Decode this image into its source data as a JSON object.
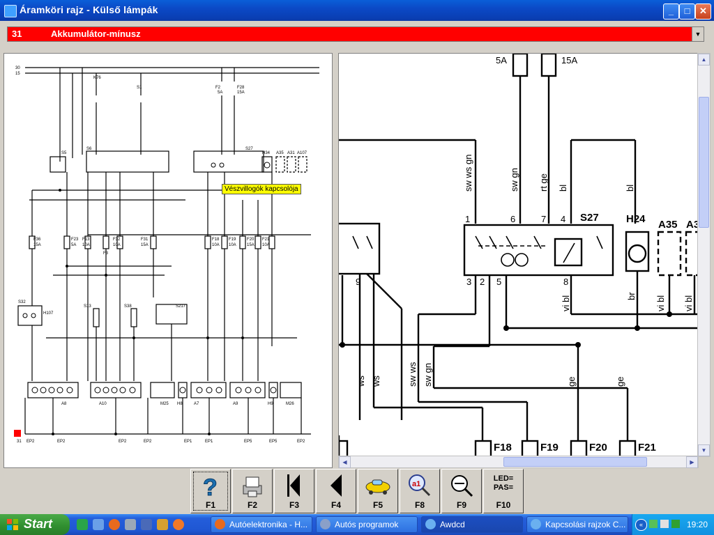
{
  "window": {
    "title": "Áramköri rajz - Külső lámpák",
    "minimize_label": "_",
    "maximize_label": "□",
    "close_label": "✕"
  },
  "selector": {
    "code": "31",
    "label": "Akkumulátor-mínusz"
  },
  "tooltip": "Vészvillogók kapcsolója",
  "schematic_left": {
    "rails": [
      "30",
      "15"
    ],
    "components": [
      "K76",
      "S1",
      "F2",
      "F28",
      "S5",
      "S6",
      "S27",
      "H34",
      "A35",
      "A31",
      "A107",
      "F36",
      "F23",
      "F13",
      "F3",
      "F32",
      "F31",
      "F18",
      "F19",
      "F20",
      "F21",
      "S32",
      "H107",
      "S13",
      "S38",
      "S217",
      "A8",
      "A10",
      "M25",
      "H8",
      "A7",
      "A9",
      "H9",
      "M26"
    ],
    "fuse_ratings": [
      "5A",
      "15A",
      "15A",
      "5A",
      "10A",
      "10A",
      "15A",
      "10A",
      "10A",
      "15A",
      "10A"
    ],
    "ground_points": [
      "31",
      "EP2",
      "EP2",
      "EP2",
      "EP2",
      "EP1",
      "EP1",
      "EP5",
      "EP5",
      "EP2"
    ]
  },
  "schematic_right": {
    "fuse_top": [
      "5A",
      "15A"
    ],
    "wire_labels": [
      "sw ws gn",
      "sw gn",
      "rt ge",
      "bl",
      "bl",
      "vi bl",
      "br",
      "vi bl",
      "vi bl",
      "ws",
      "ws",
      "sw ws",
      "sw gn",
      "ge",
      "ge"
    ],
    "s27": {
      "name": "S27",
      "pins_top": [
        "1",
        "6",
        "7",
        "4"
      ],
      "pins_bottom": [
        "3",
        "2",
        "5",
        "8"
      ]
    },
    "h24": "H24",
    "a35": "A35",
    "a3": "A3",
    "left_pin": "9",
    "fuses_bottom": [
      "F18",
      "F19",
      "F20",
      "F21"
    ]
  },
  "function_keys": [
    {
      "key": "F1",
      "icon": "help-icon"
    },
    {
      "key": "F2",
      "icon": "printer-icon"
    },
    {
      "key": "F3",
      "icon": "first-page-icon"
    },
    {
      "key": "F4",
      "icon": "previous-page-icon"
    },
    {
      "key": "F5",
      "icon": "car-icon"
    },
    {
      "key": "F8",
      "icon": "zoom-component-icon"
    },
    {
      "key": "F9",
      "icon": "zoom-icon"
    },
    {
      "key": "F10",
      "icon": "led-pass-icon",
      "icon_text": "LED= PAS="
    }
  ],
  "taskbar": {
    "start_label": "Start",
    "tasks": [
      {
        "label": "Autóelektronika - H..."
      },
      {
        "label": "Autós programok"
      },
      {
        "label": "Awdcd"
      },
      {
        "label": "Kapcsolási rajzok C..."
      }
    ],
    "clock": "19:20"
  },
  "colors": {
    "selector_bg": "#ff0000",
    "tooltip_bg": "#ffff00",
    "titlebar": "#0b49c6",
    "taskbar": "#245edb",
    "start_button": "#2f8e2f"
  }
}
